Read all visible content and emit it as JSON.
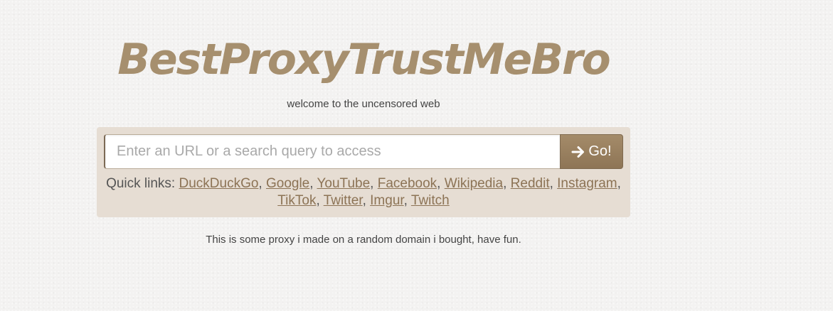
{
  "site": {
    "logo_text": "BestProxyTrustMeBro",
    "tagline": "welcome to the uncensored web"
  },
  "search": {
    "placeholder": "Enter an URL or a search query to access",
    "value": "",
    "go_label": "Go!",
    "go_icon": "arrow-right-icon"
  },
  "quick_links": {
    "label": "Quick links:",
    "items": [
      {
        "label": "DuckDuckGo"
      },
      {
        "label": "Google"
      },
      {
        "label": "YouTube"
      },
      {
        "label": "Facebook"
      },
      {
        "label": "Wikipedia"
      },
      {
        "label": "Reddit"
      },
      {
        "label": "Instagram"
      },
      {
        "label": "TikTok"
      },
      {
        "label": "Twitter"
      },
      {
        "label": "Imgur"
      },
      {
        "label": "Twitch"
      }
    ],
    "separator": ","
  },
  "footer": {
    "note": "This is some proxy i made on a random domain i bought, have fun."
  },
  "colors": {
    "brand": "#a68f6e",
    "link": "#8c7355",
    "panel": "#e6ddd3",
    "button": "#967d5e"
  }
}
